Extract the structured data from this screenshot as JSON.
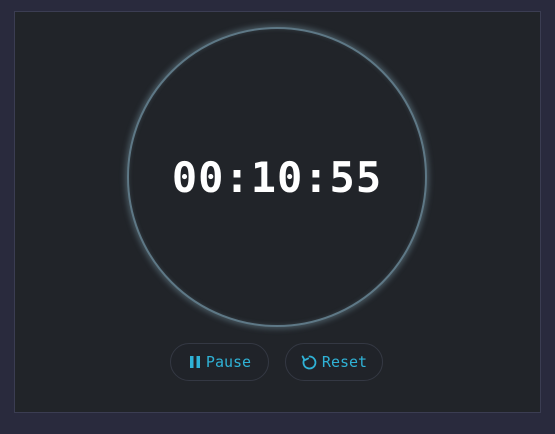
{
  "timer": {
    "display": "00:10:55"
  },
  "controls": {
    "pause_label": "Pause",
    "reset_label": "Reset"
  },
  "icons": {
    "pause": "pause-icon",
    "reset": "reset-icon"
  },
  "colors": {
    "background": "#292a3d",
    "panel": "#212429",
    "accent": "#2fb2d6",
    "ring": "#5e7886",
    "time_text": "#ffffff"
  }
}
